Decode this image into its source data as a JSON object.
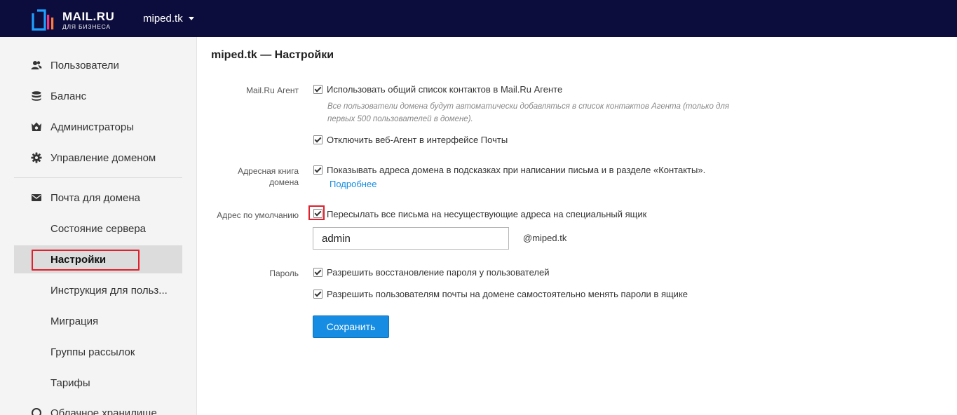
{
  "header": {
    "logo_main": "MAIL.RU",
    "logo_sub": "ДЛЯ БИЗНЕСА",
    "domain": "miped.tk",
    "domain_caret_icon": "caret-down-icon"
  },
  "sidebar": {
    "items": [
      {
        "label": "Пользователи",
        "icon": "users-icon"
      },
      {
        "label": "Баланс",
        "icon": "coins-icon"
      },
      {
        "label": "Администраторы",
        "icon": "admin-crown-icon"
      },
      {
        "label": "Управление доменом",
        "icon": "gear-icon"
      },
      {
        "label": "Почта для домена",
        "icon": "envelope-icon"
      },
      {
        "label": "Состояние сервера"
      },
      {
        "label": "Настройки",
        "active": true
      },
      {
        "label": "Инструкция для польз..."
      },
      {
        "label": "Миграция"
      },
      {
        "label": "Группы рассылок"
      },
      {
        "label": "Тарифы"
      },
      {
        "label": "Облачное хранилище",
        "icon": "cloud-icon"
      }
    ]
  },
  "main": {
    "title": "miped.tk — Настройки",
    "agent": {
      "label": "Mail.Ru Агент",
      "opt1": "Использовать общий список контактов в Mail.Ru Агенте",
      "hint": "Все пользователи домена будут автоматически добавляться в список контактов Агента (только для первых 500 пользователей в домене).",
      "opt2": "Отключить веб-Агент в интерфейсе Почты"
    },
    "addressbook": {
      "label": "Адресная книга домена",
      "opt": "Показывать адреса домена в подсказках при написании письма и в разделе «Контакты».",
      "more_link": "Подробнее"
    },
    "default_address": {
      "label": "Адрес по умолчанию",
      "opt": "Пересылать все письма на несуществующие адреса на специальный ящик",
      "input_value": "admin",
      "suffix": "@miped.tk"
    },
    "password": {
      "label": "Пароль",
      "opt1": "Разрешить восстановление пароля у пользователей",
      "opt2": "Разрешить пользователям почты на домене самостоятельно менять пароли в ящике"
    },
    "save_label": "Сохранить"
  },
  "colors": {
    "topbar": "#0d0d3d",
    "accent": "#168de2",
    "highlight": "#e0202d"
  }
}
